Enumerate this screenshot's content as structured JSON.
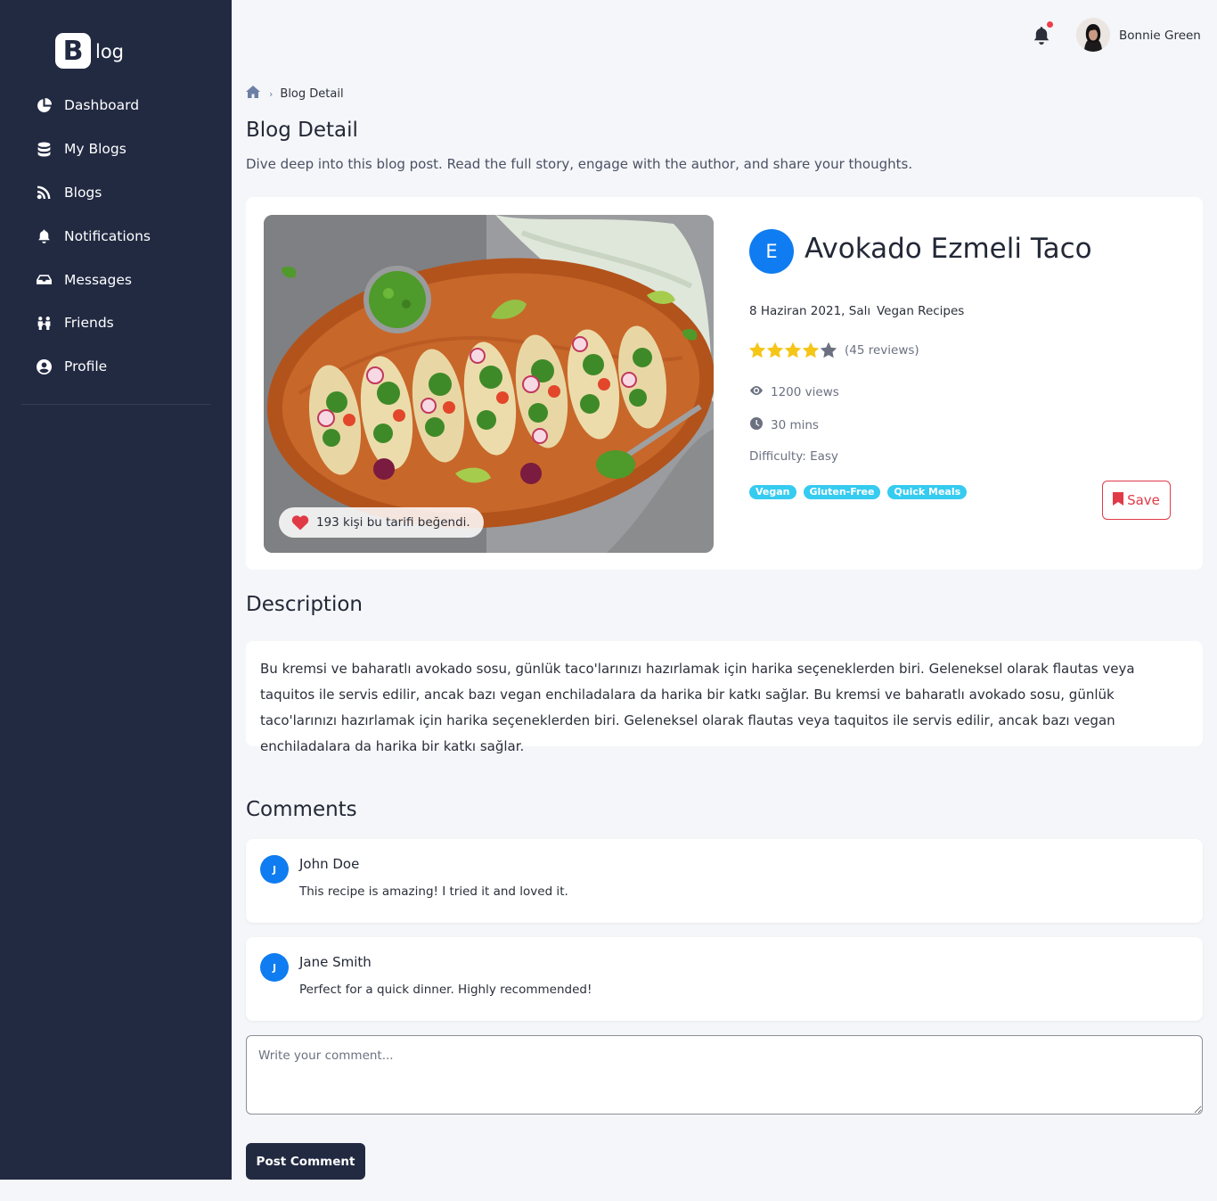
{
  "brand": {
    "logo_letter": "B",
    "logo_text": "log"
  },
  "sidebar": {
    "items": [
      {
        "label": "Dashboard",
        "icon": "pie-chart-icon"
      },
      {
        "label": "My Blogs",
        "icon": "database-icon"
      },
      {
        "label": "Blogs",
        "icon": "rss-icon"
      },
      {
        "label": "Notifications",
        "icon": "bell-icon"
      },
      {
        "label": "Messages",
        "icon": "inbox-icon"
      },
      {
        "label": "Friends",
        "icon": "people-icon"
      },
      {
        "label": "Profile",
        "icon": "user-circle-icon"
      }
    ]
  },
  "topbar": {
    "user_name": "Bonnie Green",
    "has_unread": true
  },
  "breadcrumb": {
    "current": "Blog Detail"
  },
  "page": {
    "title": "Blog Detail",
    "subtitle": "Dive deep into this blog post. Read the full story, engage with the author, and share your thoughts."
  },
  "post": {
    "author_initial": "E",
    "title": "Avokado Ezmeli Taco",
    "date": "8 Haziran 2021, Salı",
    "category": "Vegan Recipes",
    "rating": 4,
    "rating_max": 5,
    "reviews": "(45 reviews)",
    "views": "1200 views",
    "duration": "30 mins",
    "difficulty": "Difficulty: Easy",
    "tags": [
      "Vegan",
      "Gluten-Free",
      "Quick Meals"
    ],
    "likes_text": "193 kişi bu tarifi beğendi.",
    "save_label": "Save"
  },
  "description": {
    "heading": "Description",
    "text": "Bu kremsi ve baharatlı avokado sosu, günlük taco'larınızı hazırlamak için harika seçeneklerden biri. Geleneksel olarak flautas veya taquitos ile servis edilir, ancak bazı vegan enchiladalara da harika bir katkı sağlar. Bu kremsi ve baharatlı avokado sosu, günlük taco'larınızı hazırlamak için harika seçeneklerden biri. Geleneksel olarak flautas veya taquitos ile servis edilir, ancak bazı vegan enchiladalara da harika bir katkı sağlar."
  },
  "comments": {
    "heading": "Comments",
    "items": [
      {
        "initial": "J",
        "name": "John Doe",
        "text": "This recipe is amazing! I tried it and loved it."
      },
      {
        "initial": "J",
        "name": "Jane Smith",
        "text": "Perfect for a quick dinner. Highly recommended!"
      }
    ],
    "placeholder": "Write your comment...",
    "submit_label": "Post Comment"
  },
  "colors": {
    "sidebar_bg": "#222a42",
    "accent_blue": "#0f7cf1",
    "save_red": "#e03a47",
    "tag_cyan": "#36cbf0",
    "star_gold": "#f5c518"
  }
}
